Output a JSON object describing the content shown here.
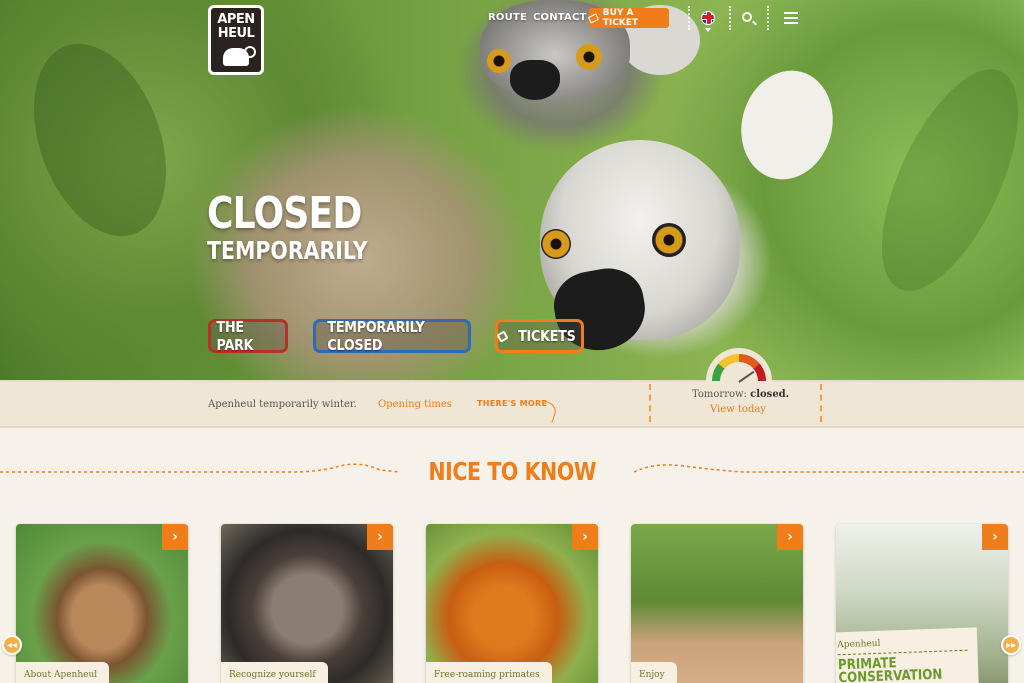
{
  "header": {
    "logo_line1": "APEN",
    "logo_line2": "HEUL",
    "nav": {
      "route": "ROUTE",
      "contact": "CONTACT"
    },
    "buy_ticket": "BUY A TICKET",
    "language_flag": "uk-flag-icon",
    "search_icon": "search-icon",
    "menu_icon": "hamburger-menu-icon"
  },
  "hero": {
    "title_big": "CLOSED",
    "title_small": "TEMPORARILY",
    "buttons": [
      {
        "label": "THE PARK",
        "color": "#b5322b"
      },
      {
        "label": "TEMPORARILY CLOSED",
        "color": "#2f6bb5"
      },
      {
        "label": "TICKETS",
        "color": "#f07c1a"
      }
    ]
  },
  "infobar": {
    "status_text": "Apenheul temporarily winter.",
    "opening_times": "Opening times",
    "more": "THERE'S MORE",
    "tomorrow_prefix": "Tomorrow:",
    "tomorrow_status": "closed.",
    "view_today": "View today"
  },
  "section": {
    "title": "NICE TO KNOW",
    "cards": [
      {
        "label": "About Apenheul"
      },
      {
        "label": "Recognize yourself"
      },
      {
        "label": "Free-roaming primates"
      },
      {
        "label": "Enjoy"
      },
      {
        "label_small": "Apenheul",
        "label_big_1": "PRIMATE",
        "label_big_2": "CONSERVATION"
      }
    ],
    "prev": "◂◂",
    "next": "▸▸",
    "card_arrow": "›"
  },
  "colors": {
    "accent": "#f07c1a",
    "green": "#6b7a2a",
    "bg": "#f6f1e9"
  }
}
